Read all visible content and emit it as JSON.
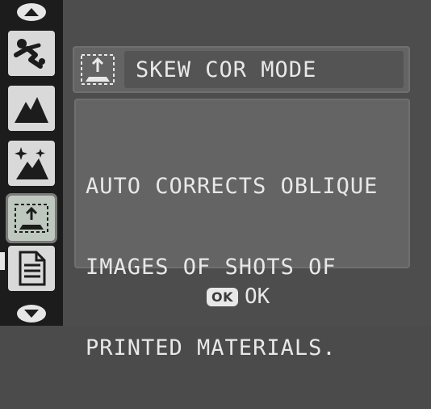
{
  "title_bar": {
    "label": "SKEW COR MODE",
    "icon": "skew-correction-icon"
  },
  "description": {
    "lines": [
      "AUTO CORRECTS OBLIQUE",
      "IMAGES OF SHOTS OF",
      "PRINTED MATERIALS."
    ]
  },
  "footer": {
    "ok_badge": "OK",
    "ok_label": "OK"
  },
  "sidebar": {
    "items": [
      {
        "icon": "sports-icon"
      },
      {
        "icon": "landscape-icon"
      },
      {
        "icon": "night-scene-icon"
      },
      {
        "icon": "skew-correction-icon",
        "selected": true
      },
      {
        "icon": "text-mode-icon"
      }
    ],
    "scroll_up_icon": "up-arrow-icon",
    "scroll_down_icon": "down-arrow-icon"
  },
  "colors": {
    "panel": "#646464",
    "background": "#4d4d4d",
    "sidebar": "#1c1c1c",
    "text": "#e8e8e8"
  }
}
